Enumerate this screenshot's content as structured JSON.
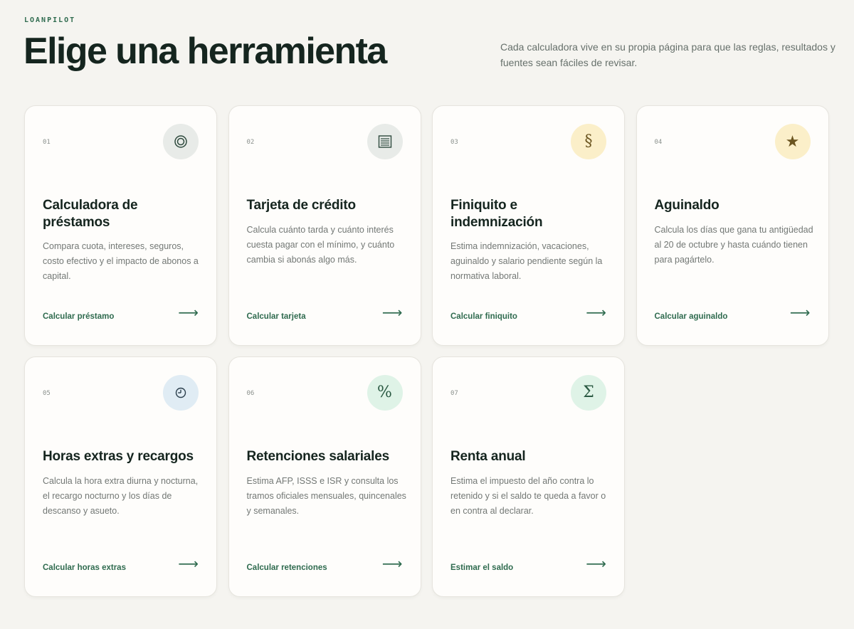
{
  "brand": "LOANPILOT",
  "title": "Elige una herramienta",
  "intro": "Cada calculadora vive en su propia página para que las reglas, resultados y fuentes sean fáciles de revisar.",
  "colors": {
    "background": "#f5f4f0",
    "accent": "#2f6b4f",
    "heading": "#15251f",
    "body_text": "#737875",
    "icon_gray": "#e8ebe8",
    "icon_yellow": "#fbefc9",
    "icon_blue": "#e0ecf4",
    "icon_green": "#dff3e7"
  },
  "cards": [
    {
      "number": "01",
      "icon": "target-icon",
      "icon_glyph": "◎",
      "title": "Calculadora de préstamos",
      "description": "Compara cuota, intereses, seguros, costo efectivo y el impacto de abonos a capital.",
      "link": "Calcular préstamo",
      "arrow": "⟶"
    },
    {
      "number": "02",
      "icon": "card-icon",
      "icon_glyph": "▤",
      "title": "Tarjeta de crédito",
      "description": "Calcula cuánto tarda y cuánto interés cuesta pagar con el mínimo, y cuánto cambia si abonás algo más.",
      "link": "Calcular tarjeta",
      "arrow": "⟶"
    },
    {
      "number": "03",
      "icon": "section-icon",
      "icon_glyph": "§",
      "title": "Finiquito e indemnización",
      "description": "Estima indemnización, vacaciones, aguinaldo y salario pendiente según la normativa laboral.",
      "link": "Calcular finiquito",
      "arrow": "⟶"
    },
    {
      "number": "04",
      "icon": "star-icon",
      "icon_glyph": "★",
      "title": "Aguinaldo",
      "description": "Calcula los días que gana tu antigüedad al 20 de octubre y hasta cuándo tienen para pagártelo.",
      "link": "Calcular aguinaldo",
      "arrow": "⟶"
    },
    {
      "number": "05",
      "icon": "clock-icon",
      "icon_glyph": "◷",
      "title": "Horas extras y recargos",
      "description": "Calcula la hora extra diurna y nocturna, el recargo nocturno y los días de descanso y asueto.",
      "link": "Calcular horas extras",
      "arrow": "⟶"
    },
    {
      "number": "06",
      "icon": "percent-icon",
      "icon_glyph": "%",
      "title": "Retenciones salariales",
      "description": "Estima AFP, ISSS e ISR y consulta los tramos oficiales mensuales, quincenales y semanales.",
      "link": "Calcular retenciones",
      "arrow": "⟶"
    },
    {
      "number": "07",
      "icon": "sigma-icon",
      "icon_glyph": "Σ",
      "title": "Renta anual",
      "description": "Estima el impuesto del año contra lo retenido y si el saldo te queda a favor o en contra al declarar.",
      "link": "Estimar el saldo",
      "arrow": "⟶"
    }
  ]
}
